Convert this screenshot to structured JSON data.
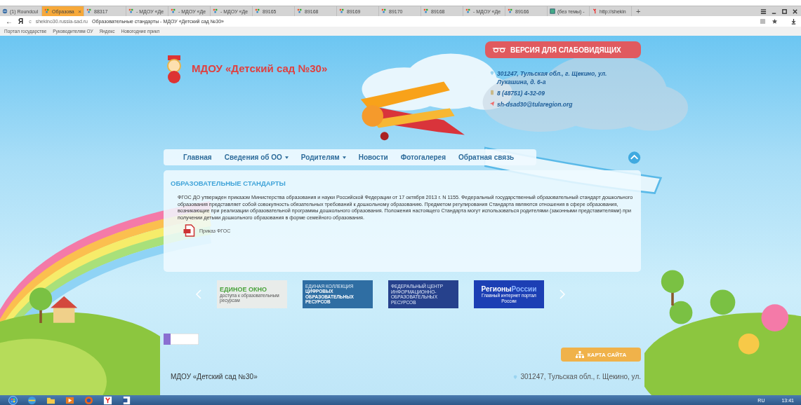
{
  "browser": {
    "tabs": [
      {
        "label": "(1) Roundcul",
        "kind": "mail",
        "selected": false
      },
      {
        "label": "Образова",
        "kind": "site",
        "selected": true
      },
      {
        "label": "88317",
        "kind": "site",
        "selected": false
      },
      {
        "label": "- МДОУ «Де",
        "kind": "site",
        "selected": false
      },
      {
        "label": "- МДОУ «Де",
        "kind": "site",
        "selected": false
      },
      {
        "label": "- МДОУ «Де",
        "kind": "site",
        "selected": false
      },
      {
        "label": "89165",
        "kind": "site",
        "selected": false
      },
      {
        "label": "89168",
        "kind": "site",
        "selected": false
      },
      {
        "label": "89169",
        "kind": "site",
        "selected": false
      },
      {
        "label": "89170",
        "kind": "site",
        "selected": false
      },
      {
        "label": "89168",
        "kind": "site",
        "selected": false
      },
      {
        "label": "- МДОУ «Де",
        "kind": "site",
        "selected": false
      },
      {
        "label": "89166",
        "kind": "site",
        "selected": false
      },
      {
        "label": "(без темы) -",
        "kind": "picture",
        "selected": false
      },
      {
        "label": "http://shekin",
        "kind": "yandex",
        "selected": false
      }
    ],
    "tab_close": "×",
    "new_tab": "+",
    "back": "←",
    "home_logo": "Я",
    "reload": "c",
    "domain": "shekino30.russia-sad.ru",
    "page_title": "Образовательные стандарты - МДОУ «Детский сад №30»",
    "bookmarks": [
      "Портал государстве",
      "Руководителям ОУ",
      "Яндекс",
      "Новогодние прикл"
    ]
  },
  "site": {
    "name": "МДОУ «Детский сад №30»",
    "accessibility_button": "ВЕРСИЯ ДЛЯ СЛАБОВИДЯЩИХ",
    "contacts": [
      {
        "kind": "address",
        "text": "301247, Тульская обл., г. Щекино, ул. Лукашина, д. 6-а"
      },
      {
        "kind": "phone",
        "text": "8 (48751) 4-32-09"
      },
      {
        "kind": "email",
        "text": "sh-dsad30@tularegion.org"
      }
    ],
    "nav": [
      {
        "label": "Главная",
        "dropdown": false
      },
      {
        "label": "Сведения об ОО",
        "dropdown": true
      },
      {
        "label": "Родителям",
        "dropdown": true
      },
      {
        "label": "Новости",
        "dropdown": false
      },
      {
        "label": "Фотогалерея",
        "dropdown": false
      },
      {
        "label": "Обратная связь",
        "dropdown": false
      }
    ],
    "article": {
      "heading": "ОБРАЗОВАТЕЛЬНЫЕ СТАНДАРТЫ",
      "text": "ФГОС ДО утвержден приказом Министерства образования и науки Российской Федерации от 17 октября 2013 г. N 1155. Федеральный государственный образовательный стандарт дошкольного образования представляет собой совокупность обязательных требований к дошкольному образованию. Предметом регулирования Стандарта являются отношения в сфере образования, возникающие при реализации образовательной программы дошкольного образования. Положения настоящего Стандарта могут использоваться родителями (законными представителями) при получении детьми дошкольного образования в форме семейного образования.",
      "attachment": "Приказ ФГОС"
    },
    "banners": [
      {
        "kind": "window",
        "title": "ЕДИНОЕ ОКНО",
        "subtitle": "доступа к образовательным ресурсам"
      },
      {
        "kind": "collection",
        "title": "ЕДИНАЯ КОЛЛЕКЦИЯ",
        "subtitle": "ЦИФРОВЫХ ОБРАЗОВАТЕЛЬНЫХ РЕСУРСОВ"
      },
      {
        "kind": "center",
        "title": "ФЕДЕРАЛЬНЫЙ ЦЕНТР ИНФОРМАЦИОННО-ОБРАЗОВАТЕЛЬНЫХ РЕСУРСОВ"
      },
      {
        "kind": "regions",
        "title": "Регионы",
        "title_accent": "России",
        "subtitle": "Главный интернет портал России"
      }
    ],
    "sitemap_button": "КАРТА САЙТА",
    "footer_name": "МДОУ «Детский сад №30»",
    "footer_address": "301247, Тульская обл., г. Щекино, ул."
  },
  "taskbar": {
    "language": "RU",
    "time": "13:41"
  }
}
